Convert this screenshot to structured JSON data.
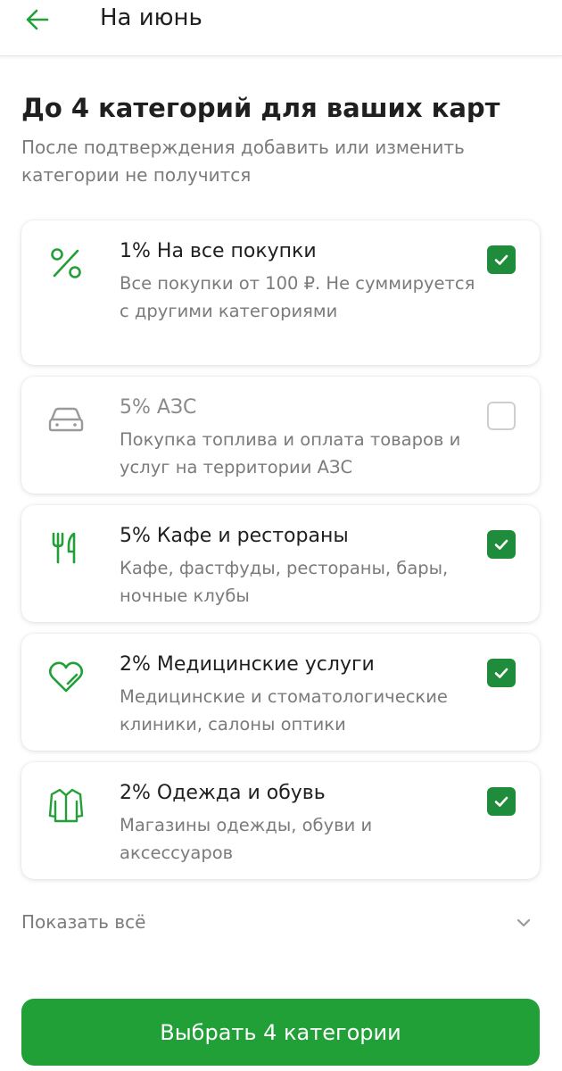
{
  "header": {
    "title": "На июнь"
  },
  "heading": "До 4 категорий для ваших карт",
  "subheading": "После подтверждения добавить или изменить категории не получится",
  "categories": [
    {
      "title": "1% На все покупки",
      "description": "Все покупки от 100 ₽. Не суммируется с другими категориями",
      "icon": "percent-icon",
      "checked": true
    },
    {
      "title": "5% АЗС",
      "description": "Покупка топлива и оплата товаров и услуг на территории АЗС",
      "icon": "car-icon",
      "checked": false
    },
    {
      "title": "5% Кафе и рестораны",
      "description": "Кафе, фастфуды, рестораны, бары, ночные клубы",
      "icon": "fork-knife-icon",
      "checked": true
    },
    {
      "title": "2% Медицинские услуги",
      "description": "Медицинские и стоматологические клиники, салоны оптики",
      "icon": "heart-icon",
      "checked": true
    },
    {
      "title": "2% Одежда и обувь",
      "description": "Магазины одежды, обуви и аксессуаров",
      "icon": "coat-icon",
      "checked": true
    }
  ],
  "show_all": {
    "label": "Показать всё"
  },
  "primary_button": {
    "label": "Выбрать 4 категории"
  },
  "colors": {
    "accent": "#21a038",
    "checkbox": "#1f8c3b",
    "muted_text": "#7b7b7b"
  }
}
